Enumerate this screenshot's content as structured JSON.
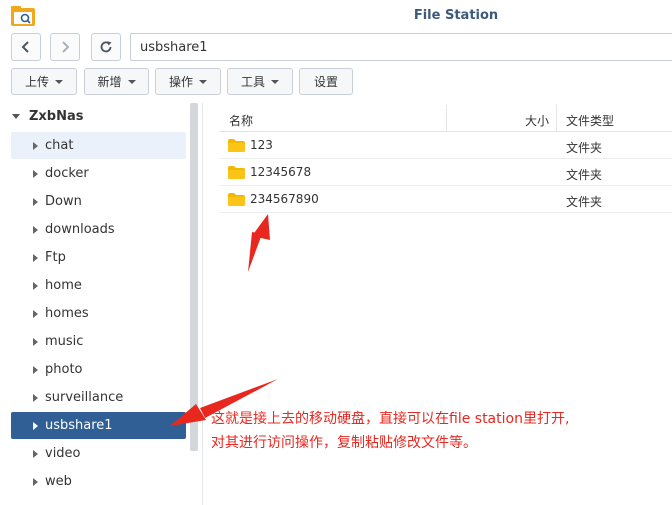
{
  "window": {
    "title": "File Station"
  },
  "nav": {
    "path": "usbshare1"
  },
  "toolbar": {
    "upload": "上传",
    "create": "新增",
    "action": "操作",
    "tools": "工具",
    "settings": "设置"
  },
  "sidebar": {
    "root": "ZxbNas",
    "items": [
      {
        "label": "chat"
      },
      {
        "label": "docker"
      },
      {
        "label": "Down"
      },
      {
        "label": "downloads"
      },
      {
        "label": "Ftp"
      },
      {
        "label": "home"
      },
      {
        "label": "homes"
      },
      {
        "label": "music"
      },
      {
        "label": "photo"
      },
      {
        "label": "surveillance"
      },
      {
        "label": "usbshare1"
      },
      {
        "label": "video"
      },
      {
        "label": "web"
      }
    ],
    "selected": "usbshare1"
  },
  "filelist": {
    "columns": {
      "name": "名称",
      "size": "大小",
      "type": "文件类型"
    },
    "rows": [
      {
        "name": "123",
        "type": "文件夹"
      },
      {
        "name": "12345678",
        "type": "文件夹"
      },
      {
        "name": "234567890",
        "type": "文件夹"
      }
    ]
  },
  "annotation": {
    "line1": "这就是接上去的移动硬盘，直接可以在file station里打开,",
    "line2": "对其进行访问操作，复制粘贴修改文件等。"
  },
  "colors": {
    "selected": "#2f5f94",
    "folder": "#f5b800",
    "annotation": "#e8271f",
    "title": "#3d5a7c"
  },
  "icons": [
    "file-station-icon",
    "back-icon",
    "forward-icon",
    "refresh-icon",
    "folder-icon",
    "expand-icon",
    "collapse-icon"
  ]
}
